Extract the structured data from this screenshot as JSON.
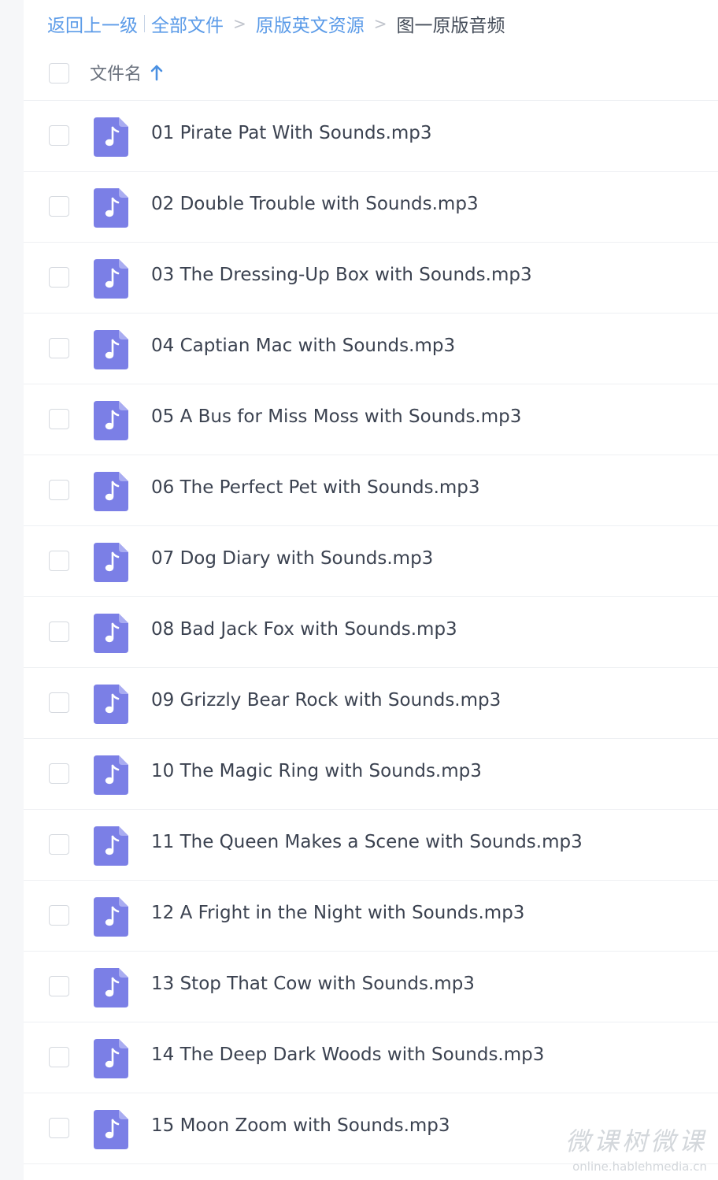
{
  "breadcrumb": {
    "back": "返回上一级",
    "root": "全部文件",
    "parent": "原版英文资源",
    "separator": ">",
    "current": "图一原版音频"
  },
  "header": {
    "column_label": "文件名",
    "sort_icon": "arrow-up-icon"
  },
  "colors": {
    "link": "#5b9be8",
    "audio_icon": "#7b7fe6"
  },
  "files": [
    {
      "name": "01 Pirate Pat With Sounds.mp3"
    },
    {
      "name": "02 Double Trouble with Sounds.mp3"
    },
    {
      "name": "03 The Dressing-Up Box with Sounds.mp3"
    },
    {
      "name": "04 Captian Mac with Sounds.mp3"
    },
    {
      "name": "05 A Bus for Miss Moss with Sounds.mp3"
    },
    {
      "name": "06 The Perfect Pet with Sounds.mp3"
    },
    {
      "name": "07 Dog Diary with Sounds.mp3"
    },
    {
      "name": "08 Bad Jack Fox with Sounds.mp3"
    },
    {
      "name": "09 Grizzly Bear Rock with Sounds.mp3"
    },
    {
      "name": "10 The Magic Ring with Sounds.mp3"
    },
    {
      "name": "11 The Queen Makes a Scene with Sounds.mp3"
    },
    {
      "name": "12 A Fright in the Night with Sounds.mp3"
    },
    {
      "name": "13 Stop That Cow with Sounds.mp3"
    },
    {
      "name": "14 The Deep Dark Woods with Sounds.mp3"
    },
    {
      "name": "15 Moon Zoom with Sounds.mp3"
    }
  ],
  "watermark": {
    "text": "微课树微课",
    "url": "online.hablehmedia.cn"
  }
}
